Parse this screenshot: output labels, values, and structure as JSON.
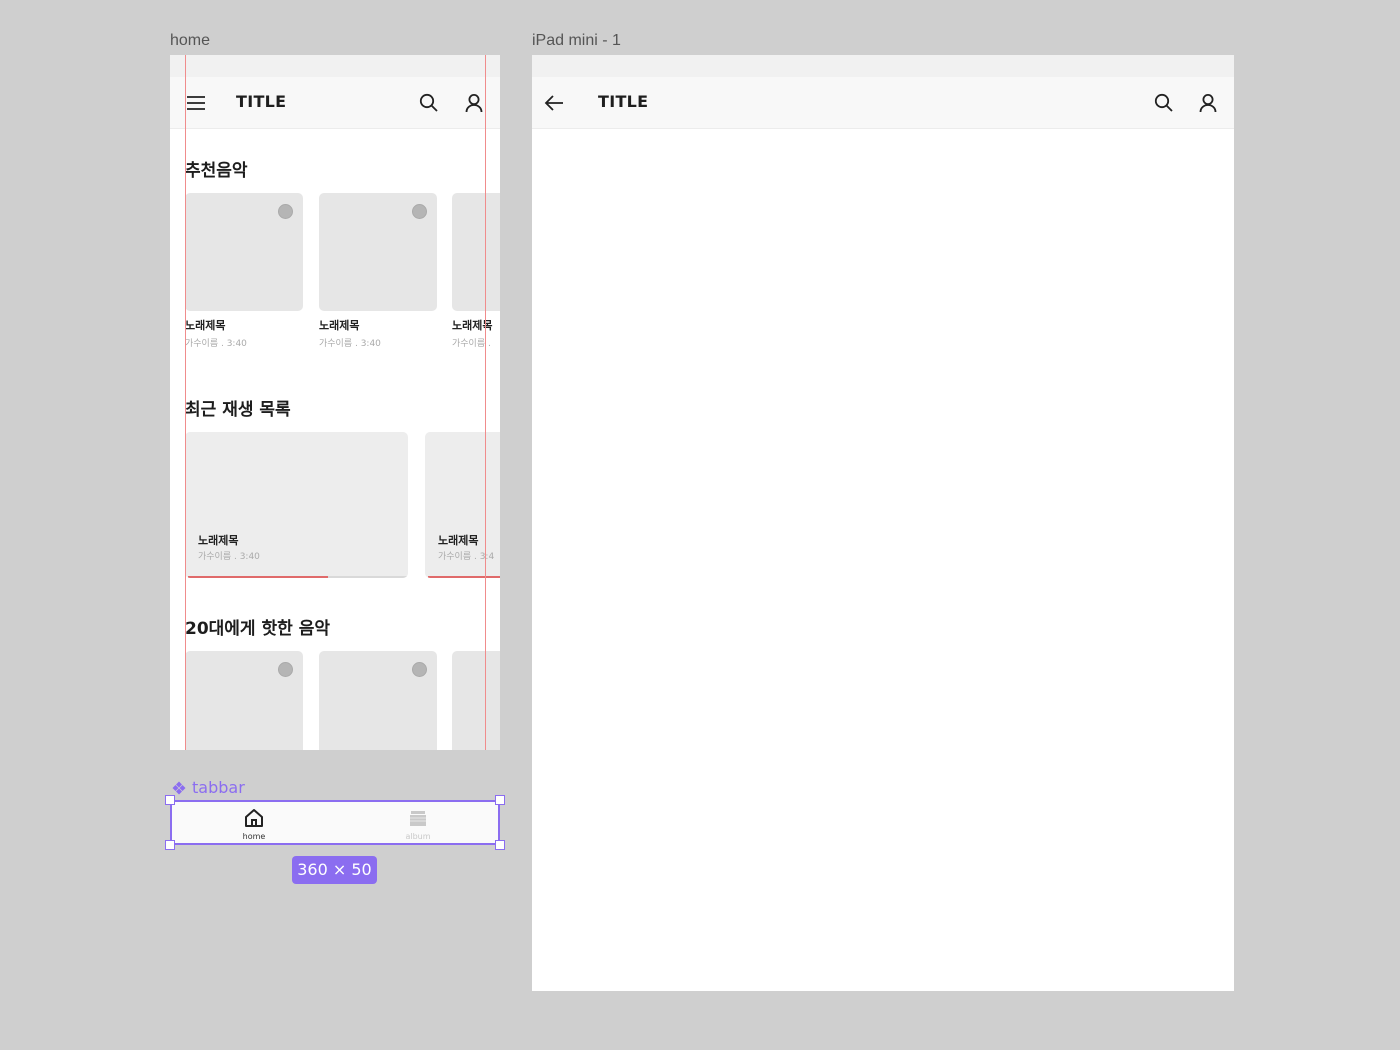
{
  "frames": {
    "home_label": "home",
    "ipad_label": "iPad mini - 1"
  },
  "home": {
    "appbar_title": "TITLE",
    "sections": {
      "recommended": {
        "title": "추천음악",
        "items": [
          {
            "title": "노래제목",
            "meta": "가수이름 . 3:40"
          },
          {
            "title": "노래제목",
            "meta": "가수이름 . 3:40"
          },
          {
            "title": "노래제목",
            "meta": "가수이름 ."
          }
        ]
      },
      "recent": {
        "title": "최근 재생 목록",
        "items": [
          {
            "title": "노래제목",
            "meta": "가수이름 . 3:40",
            "progress": 0.63
          },
          {
            "title": "노래제목",
            "meta": "가수이름 . 3:4",
            "progress": 1.0
          }
        ]
      },
      "twenties": {
        "title": "20대에게 핫한 음악"
      }
    }
  },
  "tabbar": {
    "component_label": "tabbar",
    "size_badge": "360 × 50",
    "tabs": [
      {
        "label": "home",
        "active": true
      },
      {
        "label": "album",
        "active": false
      }
    ]
  },
  "ipad": {
    "appbar_title": "TITLE"
  },
  "colors": {
    "selection": "#8b6df0",
    "guide": "#f08c8c",
    "progress": "#e06a6a"
  }
}
